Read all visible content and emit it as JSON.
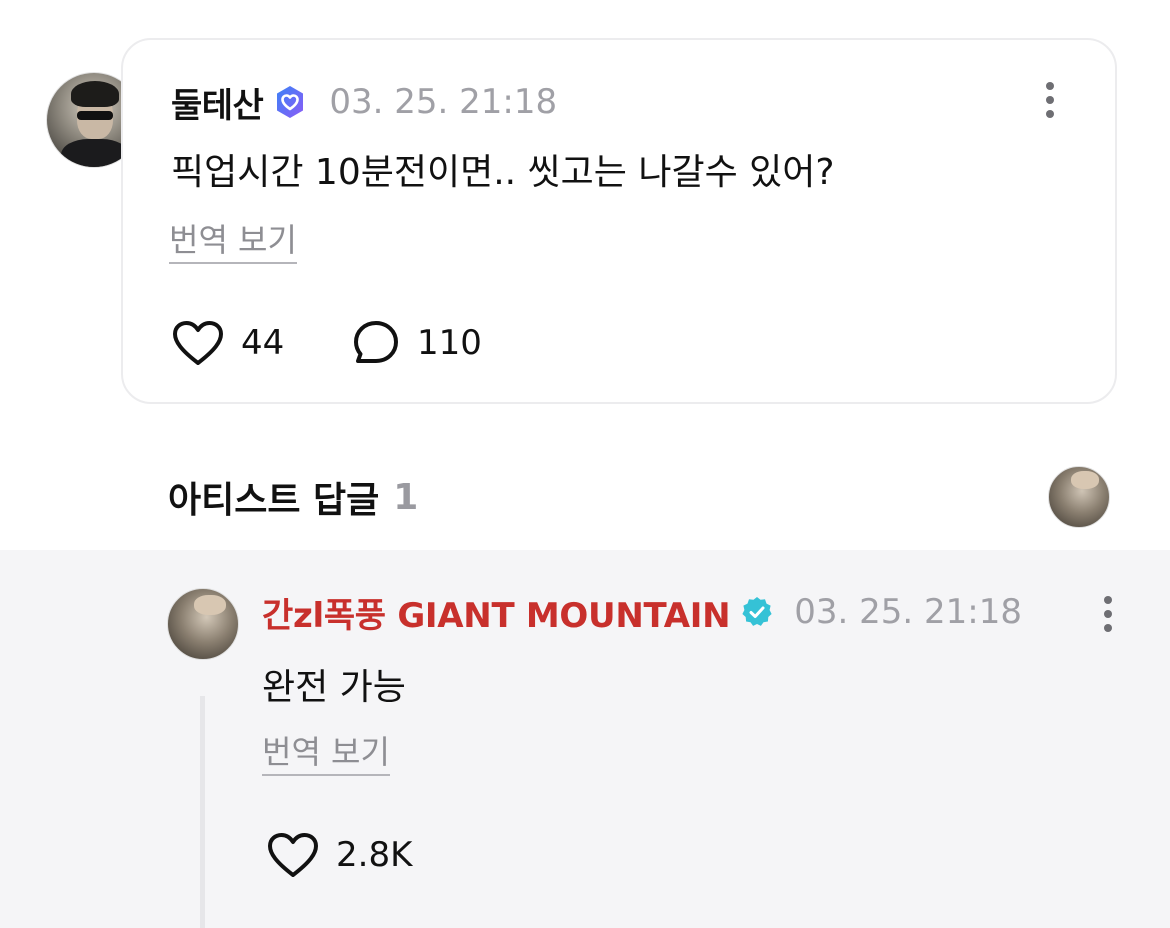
{
  "post": {
    "author": "둘테산",
    "timestamp": "03. 25. 21:18",
    "text": "픽업시간 10분전이면.. 씻고는 나갈수 있어?",
    "translate_label": "번역 보기",
    "likes": "44",
    "comments": "110",
    "badge_icon": "fan-heart-badge-icon",
    "badge_colors": [
      "#3b82f6",
      "#8b5cf6"
    ]
  },
  "artist_replies": {
    "title": "아티스트 답글",
    "count": "1"
  },
  "reply": {
    "author": "간zl폭풍 GIANT MOUNTAIN",
    "timestamp": "03. 25. 21:18",
    "text": "완전 가능",
    "translate_label": "번역 보기",
    "likes": "2.8K",
    "author_color": "#c8302c",
    "badge_icon": "verified-check-icon",
    "badge_color": "#35c2d6"
  },
  "colors": {
    "muted_text": "#a0a0a6",
    "reply_background": "#f5f5f7",
    "card_border": "#ececee"
  }
}
